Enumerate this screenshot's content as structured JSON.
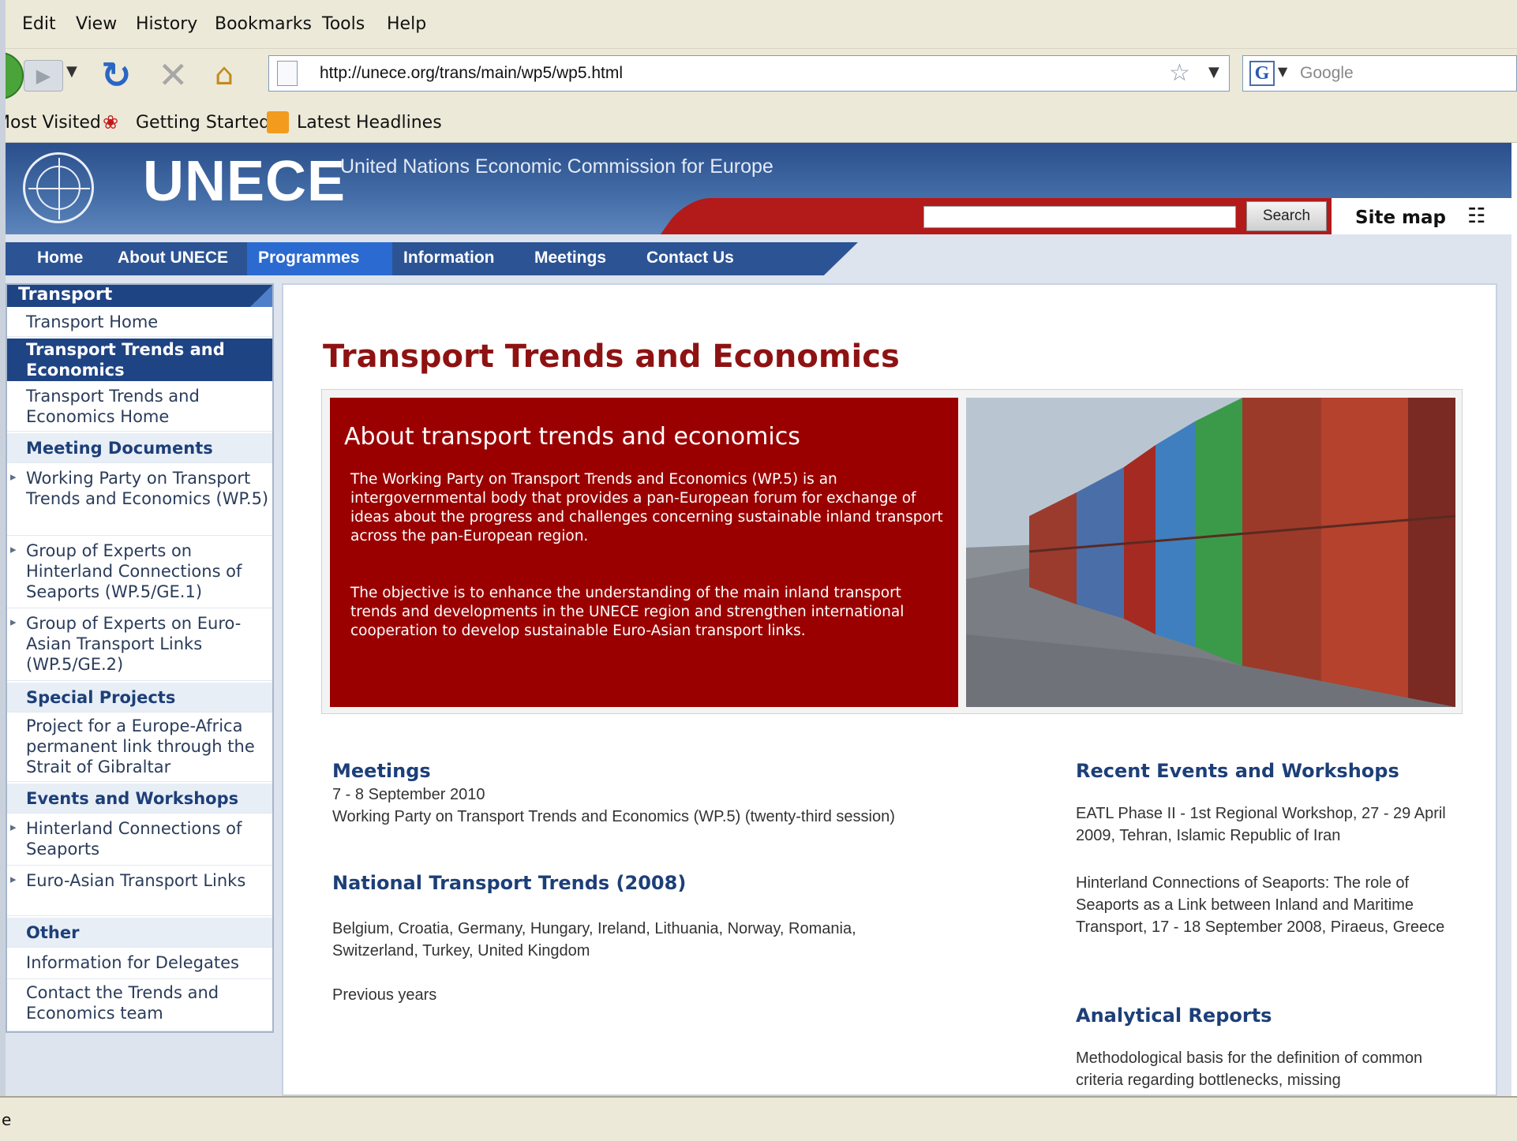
{
  "menubar": {
    "items": [
      "Edit",
      "View",
      "History",
      "Bookmarks",
      "Tools",
      "Help"
    ]
  },
  "navbar": {
    "url": "http://unece.org/trans/main/wp5/wp5.html",
    "search_placeholder": "Google"
  },
  "bookmarks": {
    "items": [
      "Most Visited",
      "Getting Started",
      "Latest Headlines"
    ]
  },
  "header": {
    "title": "UNECE",
    "subtitle": "United Nations Economic Commission for Europe",
    "search_button": "Search",
    "sitemap": "Site map"
  },
  "nav": {
    "items": [
      "Home",
      "About UNECE",
      "Programmes",
      "Information",
      "Meetings",
      "Contact Us"
    ],
    "active": "Programmes"
  },
  "sidebar": {
    "section": "Transport",
    "items": [
      "Transport Home",
      "Transport Trends and Economics",
      "Transport Trends and Economics Home",
      "Meeting Documents",
      "Working Party on Transport Trends and Economics (WP.5)",
      "Group of Experts on Hinterland Connections of Seaports (WP.5/GE.1)",
      "Group of Experts on Euro-Asian Transport Links (WP.5/GE.2)",
      "Special Projects",
      "Project for a Europe-Africa permanent link through the Strait of Gibraltar",
      "Events and Workshops",
      "Hinterland Connections of Seaports",
      "Euro-Asian Transport Links",
      "Other",
      "Information for Delegates",
      "Contact the Trends and Economics team"
    ]
  },
  "main": {
    "title": "Transport Trends and Economics",
    "intro": {
      "heading": "About transport trends and economics",
      "p1": "The Working Party on Transport Trends and Economics (WP.5) is an intergovernmental body that provides a pan-European forum for exchange of ideas about the progress and challenges concerning sustainable inland transport across the pan-European region.",
      "p2": "The objective is to enhance the understanding of the main inland transport trends and developments in the UNECE region and strengthen international cooperation to develop sustainable Euro-Asian transport links."
    },
    "meetings": {
      "heading": "Meetings",
      "date": "7 - 8 September 2010",
      "text": "Working Party on Transport Trends and Economics (WP.5) (twenty-third session)"
    },
    "national": {
      "heading": "National Transport Trends (2008)",
      "countries": "Belgium, Croatia, Germany, Hungary, Ireland, Lithuania, Norway, Romania, Switzerland, Turkey, United Kingdom",
      "previous": "Previous years"
    },
    "recent": {
      "heading": "Recent Events and Workshops",
      "item1": "EATL Phase II - 1st Regional Workshop, 27 - 29 April 2009, Tehran, Islamic Republic of Iran",
      "item2": "Hinterland Connections of Seaports: The role of Seaports as a Link between Inland and Maritime Transport, 17 - 18 September 2008, Piraeus, Greece"
    },
    "reports": {
      "heading": "Analytical Reports",
      "text": "Methodological basis for the definition of common criteria regarding bottlenecks, missing"
    }
  },
  "status": {
    "text": "e"
  }
}
